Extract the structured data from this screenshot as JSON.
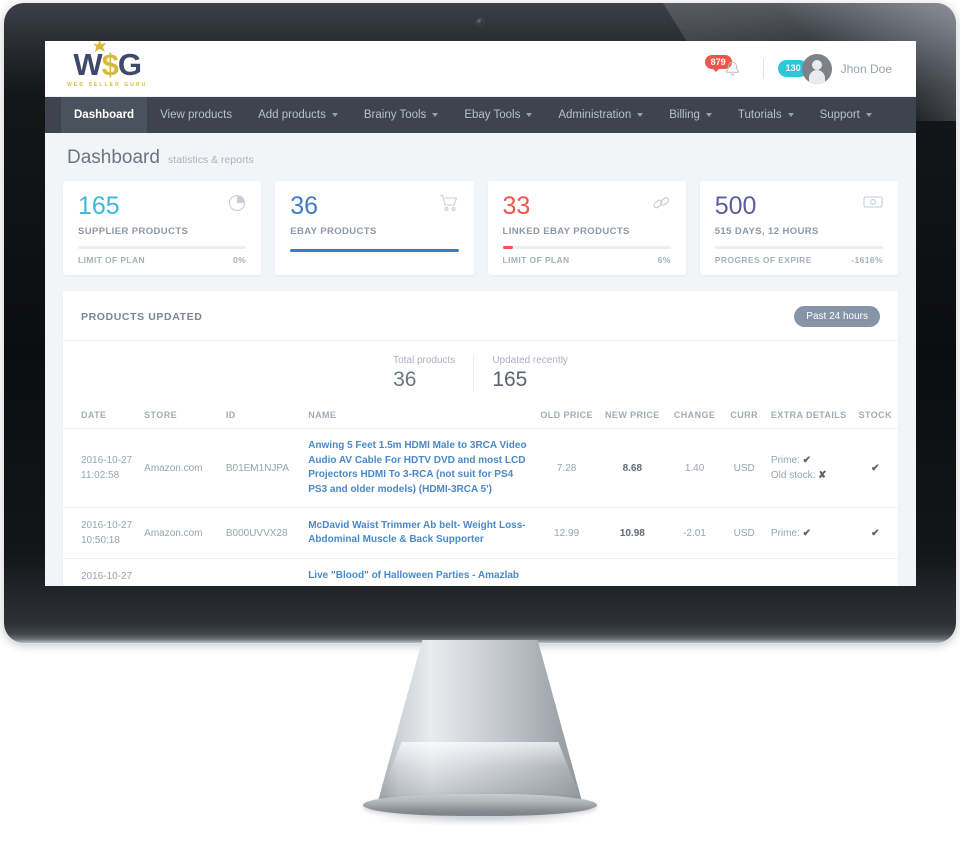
{
  "header": {
    "logo_main": "WSG",
    "logo_dollar": "$",
    "logo_sub": "WEB SELLER GURU",
    "notification_count": "879",
    "message_count": "130",
    "user_name": "Jhon Doe"
  },
  "nav": {
    "items": [
      {
        "label": "Dashboard",
        "active": true,
        "caret": false
      },
      {
        "label": "View products",
        "active": false,
        "caret": false
      },
      {
        "label": "Add products",
        "active": false,
        "caret": true
      },
      {
        "label": "Brainy Tools",
        "active": false,
        "caret": true
      },
      {
        "label": "Ebay Tools",
        "active": false,
        "caret": true
      },
      {
        "label": "Administration",
        "active": false,
        "caret": true
      },
      {
        "label": "Billing",
        "active": false,
        "caret": true
      },
      {
        "label": "Tutorials",
        "active": false,
        "caret": true
      },
      {
        "label": "Support",
        "active": false,
        "caret": true
      }
    ]
  },
  "page": {
    "title": "Dashboard",
    "subtitle": "statistics & reports"
  },
  "stat_cards": [
    {
      "value": "165",
      "label": "SUPPLIER PRODUCTS",
      "icon": "pie-chart-icon",
      "foot_label": "LIMIT OF PLAN",
      "foot_value": "0%",
      "progress_percent": 0,
      "color": "#3cb8d9",
      "bar_color": "#3cb8d9"
    },
    {
      "value": "36",
      "label": "EBAY PRODUCTS",
      "icon": "shopping-cart-icon",
      "foot_label": "",
      "foot_value": "",
      "progress_percent": 100,
      "color": "#3e7dc4",
      "bar_color": "#3e7dc4"
    },
    {
      "value": "33",
      "label": "LINKED EBAY PRODUCTS",
      "icon": "link-icon",
      "foot_label": "LIMIT OF PLAN",
      "foot_value": "6%",
      "progress_percent": 6,
      "color": "#f0564a",
      "bar_color": "#f0564a"
    },
    {
      "value": "500",
      "label": "515 DAYS, 12 HOURS",
      "icon": "money-icon",
      "foot_label": "PROGRES OF EXPIRE",
      "foot_value": "-1616%",
      "progress_percent": 0,
      "color": "#5b5f9e",
      "bar_color": "#5b5f9e"
    }
  ],
  "products_panel": {
    "title": "PRODUCTS UPDATED",
    "range_button": "Past 24 hours",
    "totals": [
      {
        "label": "Total products",
        "value": "36"
      },
      {
        "label": "Updated recently",
        "value": "165"
      }
    ],
    "columns": [
      "DATE",
      "STORE",
      "ID",
      "NAME",
      "OLD PRICE",
      "NEW PRICE",
      "CHANGE",
      "CURR",
      "EXTRA DETAILS",
      "STOCK"
    ],
    "rows": [
      {
        "date": "2016-10-27",
        "time": "11:02:58",
        "store": "Amazon.com",
        "id": "B01EM1NJPA",
        "name": "Anwing 5 Feet 1.5m HDMI Male to 3RCA Video Audio AV Cable For HDTV DVD and most LCD Projectors HDMI To 3-RCA (not suit for PS4 PS3 and older models) (HDMI-3RCA 5')",
        "old_price": "7.28",
        "new_price": "8.68",
        "change": "1.40",
        "curr": "USD",
        "extra": [
          {
            "label": "Prime:",
            "mark": "✔"
          },
          {
            "label": "Old stock:",
            "mark": "✘"
          }
        ],
        "stock": "✔"
      },
      {
        "date": "2016-10-27",
        "time": "10:50:18",
        "store": "Amazon.com",
        "id": "B000UVVX28",
        "name": "McDavid Waist Trimmer Ab belt- Weight Loss- Abdominal Muscle & Back Supporter",
        "old_price": "12.99",
        "new_price": "10.98",
        "change": "-2.01",
        "curr": "USD",
        "extra": [
          {
            "label": "Prime:",
            "mark": "✔"
          }
        ],
        "stock": "✔"
      },
      {
        "date": "2016-10-27",
        "time": "",
        "store": "",
        "id": "",
        "name": "Live \"Blood\" of Halloween Parties - Amazlab",
        "old_price": "",
        "new_price": "",
        "change": "",
        "curr": "",
        "extra": [],
        "stock": ""
      }
    ]
  }
}
